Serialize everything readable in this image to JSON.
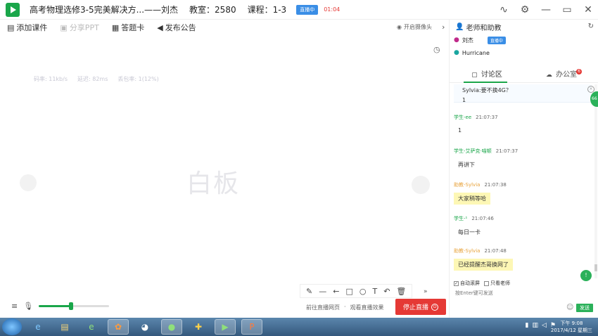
{
  "window": {
    "title": "高考物理选修3-5完美解决方...——刘杰",
    "room": "教室：2580",
    "course": "课程：1-3",
    "live_badge": "直播中",
    "timer": "01:04"
  },
  "toolbar": {
    "add_courseware": "添加课件",
    "share_ppt": "分享PPT",
    "answer_card": "答题卡",
    "post_notice": "发布公告",
    "camera": "开启摄像头"
  },
  "whiteboard": {
    "stat_bandwidth": "码率: 11kb/s",
    "stat_delay": "延迟: 82ms",
    "stat_loss": "丢包率: 1(12%)",
    "label": "白板"
  },
  "bottom": {
    "volume_level": 0.46,
    "link_web": "前往直播网页",
    "link_effect": "观看直播效果",
    "stop_label": "停止直播"
  },
  "panel": {
    "header": "老师和助教",
    "members": [
      {
        "name": "刘杰",
        "badge": "直播中"
      },
      {
        "name": "Hurricane",
        "badge": ""
      }
    ],
    "tab_discussion": "讨论区",
    "tab_office": "办公室",
    "office_badge": "6",
    "pinned_text": "Sylvia:要不换4G？",
    "pinned_value": "1",
    "messages": [
      {
        "sender": "学生-ee",
        "time": "21:07:37",
        "text": "1",
        "role": "student"
      },
      {
        "sender": "学生-艾萨克·喵顿",
        "time": "21:07:37",
        "text": "再讲下",
        "role": "student"
      },
      {
        "sender": "助教-Sylvia",
        "time": "21:07:38",
        "text": "大家稍等哈",
        "role": "assist"
      },
      {
        "sender": "学生-¹",
        "time": "21:07:46",
        "text": "每日一卡",
        "role": "student"
      },
      {
        "sender": "助教-Sylvia",
        "time": "21:07:48",
        "text": "已经提醒杰哥换网了",
        "role": "assist"
      }
    ],
    "auto_scroll": "自动滚屏",
    "only_teacher": "只看老师",
    "input_placeholder": "按Enter键可发送",
    "send": "发送",
    "float_label": "66"
  },
  "taskbar": {
    "time": "下午 9:08",
    "date": "2017/4/12 星期三"
  },
  "colors": {
    "brand_green": "#1aa64a",
    "live_blue": "#3a8ee6",
    "stop_red": "#e53935",
    "assist_orange": "#e8a33c"
  }
}
